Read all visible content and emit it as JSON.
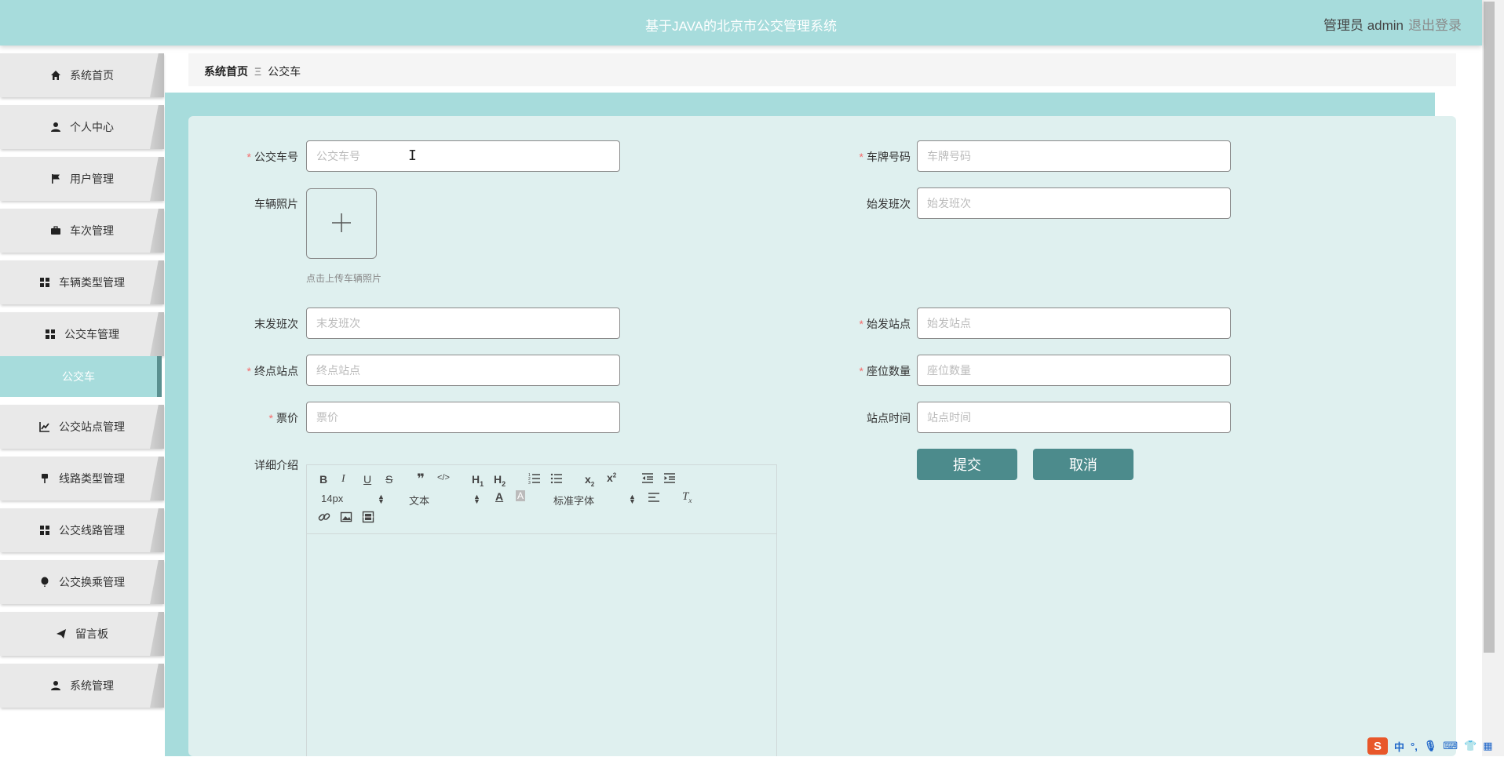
{
  "app": {
    "title": "基于JAVA的北京市公交管理系统",
    "user_label": "管理员 admin",
    "logout_label": "退出登录",
    "accent_color": "#a7dcdc",
    "button_color": "#4c8b8c"
  },
  "sidebar": {
    "items": [
      {
        "label": "系统首页",
        "icon": "home-icon"
      },
      {
        "label": "个人中心",
        "icon": "user-icon"
      },
      {
        "label": "用户管理",
        "icon": "flag-icon"
      },
      {
        "label": "车次管理",
        "icon": "briefcase-icon"
      },
      {
        "label": "车辆类型管理",
        "icon": "grid-icon"
      },
      {
        "label": "公交车管理",
        "icon": "grid-icon"
      },
      {
        "label": "公交站点管理",
        "icon": "chart-icon"
      },
      {
        "label": "线路类型管理",
        "icon": "pin-icon"
      },
      {
        "label": "公交线路管理",
        "icon": "grid-icon"
      },
      {
        "label": "公交换乘管理",
        "icon": "balloon-icon"
      },
      {
        "label": "留言板",
        "icon": "send-icon"
      },
      {
        "label": "系统管理",
        "icon": "user-icon"
      }
    ],
    "active_sub": "公交车"
  },
  "breadcrumb": {
    "home": "系统首页",
    "separator": "Ξ",
    "current": "公交车"
  },
  "form": {
    "bus_no": {
      "label": "公交车号",
      "required": true,
      "placeholder": "公交车号",
      "value": ""
    },
    "plate": {
      "label": "车牌号码",
      "required": true,
      "placeholder": "车牌号码",
      "value": ""
    },
    "photo": {
      "label": "车辆照片",
      "tip": "点击上传车辆照片"
    },
    "first_shift": {
      "label": "始发班次",
      "required": false,
      "placeholder": "始发班次",
      "value": ""
    },
    "last_shift": {
      "label": "末发班次",
      "required": false,
      "placeholder": "末发班次",
      "value": ""
    },
    "origin": {
      "label": "始发站点",
      "required": true,
      "placeholder": "始发站点",
      "value": ""
    },
    "terminal": {
      "label": "终点站点",
      "required": true,
      "placeholder": "终点站点",
      "value": ""
    },
    "seats": {
      "label": "座位数量",
      "required": true,
      "placeholder": "座位数量",
      "value": ""
    },
    "fare": {
      "label": "票价",
      "required": true,
      "placeholder": "票价",
      "value": ""
    },
    "stop_time": {
      "label": "站点时间",
      "required": false,
      "placeholder": "站点时间",
      "value": ""
    },
    "detail": {
      "label": "详细介绍"
    },
    "submit_label": "提交",
    "cancel_label": "取消"
  },
  "editor": {
    "font_size": "14px",
    "block_type": "文本",
    "font_family": "标准字体"
  },
  "ime": {
    "logo": "S",
    "mode": "中"
  }
}
